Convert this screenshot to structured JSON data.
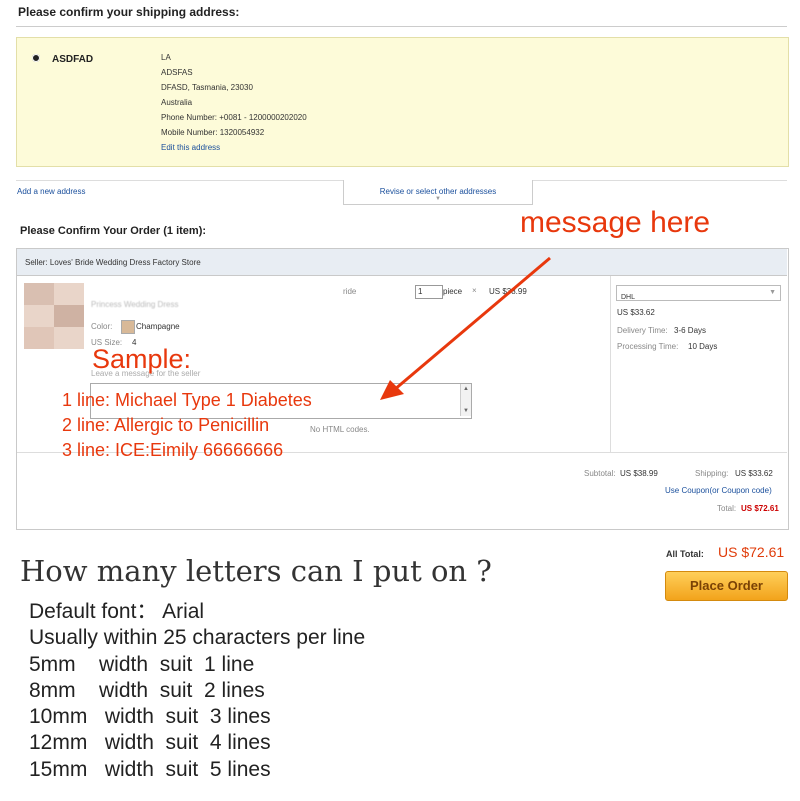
{
  "shipping": {
    "heading": "Please confirm your shipping address:",
    "name": "ASDFAD",
    "lines": [
      "LA",
      "ADSFAS",
      "DFASD, Tasmania, 23030",
      "Australia",
      "Phone Number:   +0081 - 1200000202020",
      "Mobile Number:  1320054932"
    ],
    "edit_link": "Edit this address",
    "add_new": "Add a new address",
    "revise": "Revise or select other addresses"
  },
  "order": {
    "heading": "Please Confirm Your Order (1 item):",
    "seller": "Seller: Loves' Bride Wedding Dress Factory Store",
    "product_suffix": "ride",
    "product_sub": "Princess Wedding Dress",
    "qty": "1",
    "qty_unit": "piece",
    "times": "×",
    "unit_price": "US $38.99",
    "color_label": "Color:",
    "color_value": "Champagne",
    "color_swatch": "#d8b998",
    "size_label": "US Size:",
    "size_value": "4",
    "message_label": "Leave a message for the seller",
    "no_html": "No HTML codes.",
    "shipping_method": "DHL",
    "shipping_cost": "US $33.62",
    "delivery_label": "Delivery Time:",
    "delivery_value": "3-6 Days",
    "processing_label": "Processing Time:",
    "processing_value": "10 Days",
    "subtotal_label": "Subtotal:",
    "subtotal_value": "US $38.99",
    "shipping_label": "Shipping:",
    "shipping_value": "US $33.62",
    "coupon_link": "Use Coupon(or Coupon code)",
    "total_label": "Total:",
    "total_value": "US $72.61"
  },
  "summary": {
    "all_total_label": "All Total:",
    "all_total_value": "US $72.61",
    "place_order": "Place Order"
  },
  "annotation": {
    "message_here": "message here",
    "sample_title": "Sample:",
    "sample_lines": [
      "1 line: Michael Type 1 Diabetes",
      "2 line: Allergic to Penicillin",
      "3 line: ICE:Eimily 66666666"
    ],
    "red": "#e8380d"
  },
  "faq": {
    "question": "How many letters can I put on ?",
    "lines": [
      "Default font： Arial",
      "Usually within 25 characters per line",
      "5mm    width  suit  1 line",
      "8mm    width  suit  2 lines",
      "10mm   width  suit  3 lines",
      "12mm   width  suit  4 lines",
      "15mm   width  suit  5 lines"
    ]
  }
}
